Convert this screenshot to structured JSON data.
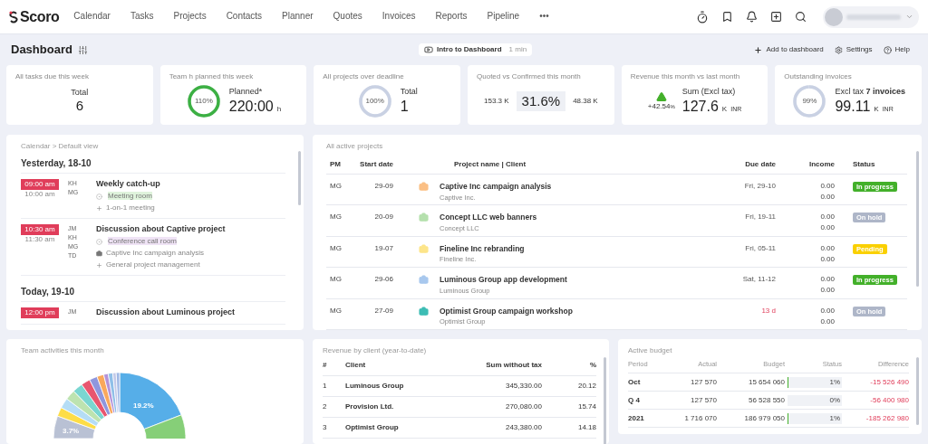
{
  "nav": {
    "logo": "Scoro",
    "items": [
      "Calendar",
      "Tasks",
      "Projects",
      "Contacts",
      "Planner",
      "Quotes",
      "Invoices",
      "Reports",
      "Pipeline",
      "•••"
    ]
  },
  "header": {
    "title": "Dashboard",
    "intro": "Intro to Dashboard",
    "intro_duration": "1 min",
    "actions": [
      "Add to dashboard",
      "Settings",
      "Help"
    ]
  },
  "kpis": [
    {
      "kind": "total",
      "title": "All tasks due this week",
      "label": "Total",
      "value": "6"
    },
    {
      "kind": "ring",
      "title": "Team h planned this week",
      "ring_text": "110%",
      "level": 1,
      "color": "#3cb043",
      "label": "Planned*",
      "value": "220:00",
      "unit": "h"
    },
    {
      "kind": "ring",
      "title": "All projects over deadline",
      "ring_text": "100%",
      "level": 1,
      "color": "#c9d1e3",
      "label": "Total",
      "value": "1"
    },
    {
      "kind": "compare",
      "title": "Quoted vs Confirmed this month",
      "left": "153.3 K",
      "value": "31.6%",
      "right": "48.38 K"
    },
    {
      "kind": "trend",
      "title": "Revenue this month vs last month",
      "change": "+42.54",
      "change_unit": "%",
      "label": "Sum (Excl tax)",
      "value": "127.6",
      "unit": "K",
      "currency": "INR"
    },
    {
      "kind": "ring",
      "title": "Outstanding invoices",
      "ring_text": "99%",
      "level": 0.99,
      "color": "#c9d1e3",
      "label": "Excl tax **7 invoices**",
      "value": "99.11",
      "unit": "K",
      "currency": "INR"
    }
  ],
  "calendar": {
    "title": "Calendar > Default view",
    "days": [
      {
        "label": "Yesterday, 18-10",
        "events": [
          {
            "start": "09:00 am",
            "end": "10:00 am",
            "people": [
              "KH",
              "MG"
            ],
            "title": "Weekly catch-up",
            "details": [
              {
                "kind": "room",
                "text": "Meeting room",
                "color": "#dff3dc"
              },
              {
                "kind": "task",
                "text": "1-on-1 meeting"
              }
            ]
          },
          {
            "start": "10:30 am",
            "end": "11:30 am",
            "people": [
              "JM",
              "KH",
              "MG",
              "TD"
            ],
            "title": "Discussion about Captive project",
            "details": [
              {
                "kind": "room",
                "text": "Conference call room",
                "color": "#efe3f5"
              },
              {
                "kind": "project",
                "text": "Captive Inc campaign analysis"
              },
              {
                "kind": "task",
                "text": "General project management"
              }
            ]
          }
        ]
      },
      {
        "label": "Today, 19-10",
        "events": [
          {
            "start": "12:00 pm",
            "people": [
              "JM"
            ],
            "title": "Discussion about Luminous project"
          }
        ]
      }
    ]
  },
  "projects": {
    "title": "All active projects",
    "columns": [
      "PM",
      "Start date",
      "Project name | Client",
      "Due date",
      "Income",
      "Status"
    ],
    "rows": [
      {
        "pm": "MG",
        "start": "29-09",
        "name": "Captive Inc campaign analysis",
        "client": "Captive Inc.",
        "color": "#fbbf84",
        "due": "Fri, 29-10",
        "overdue": false,
        "income": [
          "0.00",
          "0.00"
        ],
        "status": {
          "text": "In progress",
          "color": "#43b02a"
        }
      },
      {
        "pm": "MG",
        "start": "20-09",
        "name": "Concept LLC web banners",
        "client": "Concept LLC",
        "color": "#b5e0ad",
        "due": "Fri, 19-11",
        "overdue": false,
        "income": [
          "0.00",
          "0.00"
        ],
        "status": {
          "text": "On hold",
          "color": "#aeb6c8"
        }
      },
      {
        "pm": "MG",
        "start": "19-07",
        "name": "Fineline Inc rebranding",
        "client": "Fineline Inc.",
        "color": "#fde58a",
        "due": "Fri, 05-11",
        "overdue": false,
        "income": [
          "0.00",
          "0.00"
        ],
        "status": {
          "text": "Pending",
          "color": "#fad000"
        }
      },
      {
        "pm": "MG",
        "start": "29-06",
        "name": "Luminous Group app development",
        "client": "Luminous Group",
        "color": "#a8c8ee",
        "due": "Sat, 11-12",
        "overdue": false,
        "income": [
          "0.00",
          "0.00"
        ],
        "status": {
          "text": "In progress",
          "color": "#43b02a"
        }
      },
      {
        "pm": "MG",
        "start": "27-09",
        "name": "Optimist Group campaign workshop",
        "client": "Optimist Group",
        "color": "#3dbdb5",
        "due": "13 d",
        "overdue": true,
        "income": [
          "0.00",
          "0.00"
        ],
        "status": {
          "text": "On hold",
          "color": "#aeb6c8"
        }
      }
    ]
  },
  "team": {
    "title": "Team activities this month",
    "slice_labels": [
      "19.2%",
      "3.7%"
    ]
  },
  "revenue": {
    "title": "Revenue by client (year-to-date)",
    "columns": [
      "#",
      "Client",
      "Sum without tax",
      "%"
    ],
    "rows": [
      [
        "1",
        "Luminous Group",
        "345,330.00",
        "20.12"
      ],
      [
        "2",
        "Provision Ltd.",
        "270,080.00",
        "15.74"
      ],
      [
        "3",
        "Optimist Group",
        "243,380.00",
        "14.18"
      ]
    ]
  },
  "budget": {
    "title": "Active budget",
    "columns": [
      "Period",
      "Actual",
      "Budget",
      "Status",
      "Difference"
    ],
    "rows": [
      {
        "period": "Oct",
        "actual": "127 570",
        "budget": "15 654 060",
        "status": "1%",
        "level": 0.01,
        "difference": "-15 526 490"
      },
      {
        "period": "Q 4",
        "actual": "127 570",
        "budget": "56 528 550",
        "status": "0%",
        "level": 0,
        "difference": "-56 400 980"
      },
      {
        "period": "2021",
        "actual": "1 716 070",
        "budget": "186 979 050",
        "status": "1%",
        "level": 0.01,
        "difference": "-185 262 980"
      }
    ]
  }
}
